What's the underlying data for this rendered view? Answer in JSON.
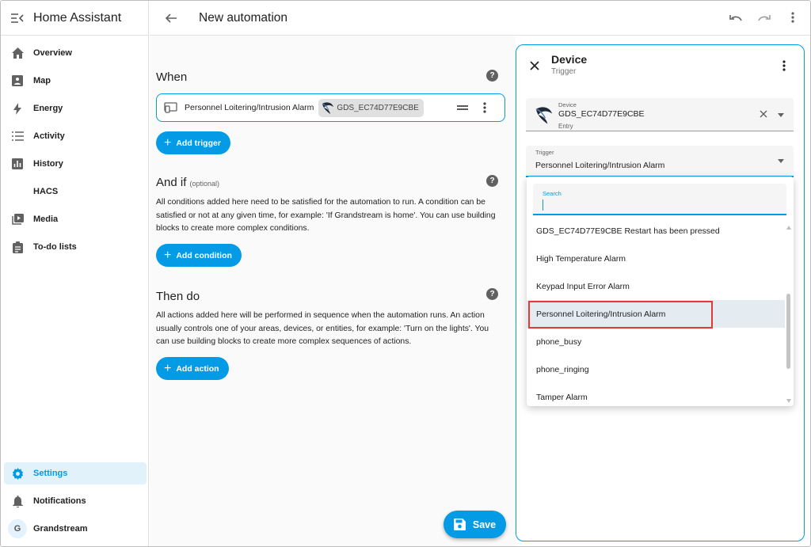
{
  "app": {
    "title": "Home Assistant"
  },
  "sidebar": {
    "items": [
      {
        "label": "Overview",
        "icon": "home-icon"
      },
      {
        "label": "Map",
        "icon": "map-icon"
      },
      {
        "label": "Energy",
        "icon": "lightning-icon"
      },
      {
        "label": "Activity",
        "icon": "list-icon"
      },
      {
        "label": "History",
        "icon": "chart-icon"
      },
      {
        "label": "HACS",
        "icon": ""
      },
      {
        "label": "Media",
        "icon": "media-icon"
      },
      {
        "label": "To-do lists",
        "icon": "clipboard-icon"
      }
    ],
    "settings": "Settings",
    "notifications": "Notifications",
    "user": {
      "name": "Grandstream",
      "initial": "G"
    }
  },
  "header": {
    "title": "New automation"
  },
  "when": {
    "title": "When",
    "trigger_label": "Personnel Loitering/Intrusion Alarm",
    "device_chip": "GDS_EC74D77E9CBE",
    "add_button": "Add trigger"
  },
  "and_if": {
    "title": "And if",
    "optional": "(optional)",
    "description": "All conditions added here need to be satisfied for the automation to run. A condition can be satisfied or not at any given time, for example: 'If Grandstream is home'. You can use building blocks to create more complex conditions.",
    "add_button": "Add condition"
  },
  "then_do": {
    "title": "Then do",
    "description": "All actions added here will be performed in sequence when the automation runs. An action usually controls one of your areas, devices, or entities, for example: 'Turn on the lights'. You can use building blocks to create more complex sequences of actions.",
    "add_button": "Add action"
  },
  "save_button": "Save",
  "panel": {
    "title": "Device",
    "subtitle": "Trigger",
    "device_field": {
      "label": "Device",
      "value": "GDS_EC74D77E9CBE",
      "sub": "Entry"
    },
    "trigger_field": {
      "label": "Trigger",
      "value": "Personnel Loitering/Intrusion Alarm"
    },
    "search": {
      "label": "Search",
      "value": ""
    },
    "options": [
      "GDS_EC74D77E9CBE Restart has been pressed",
      "High Temperature Alarm",
      "Keypad Input Error Alarm",
      "Personnel Loitering/Intrusion Alarm",
      "phone_busy",
      "phone_ringing",
      "Tamper Alarm"
    ],
    "selected_index": 3
  },
  "colors": {
    "accent": "#039be5",
    "highlight": "#e53935",
    "selected_bg": "#e4ecf2"
  }
}
